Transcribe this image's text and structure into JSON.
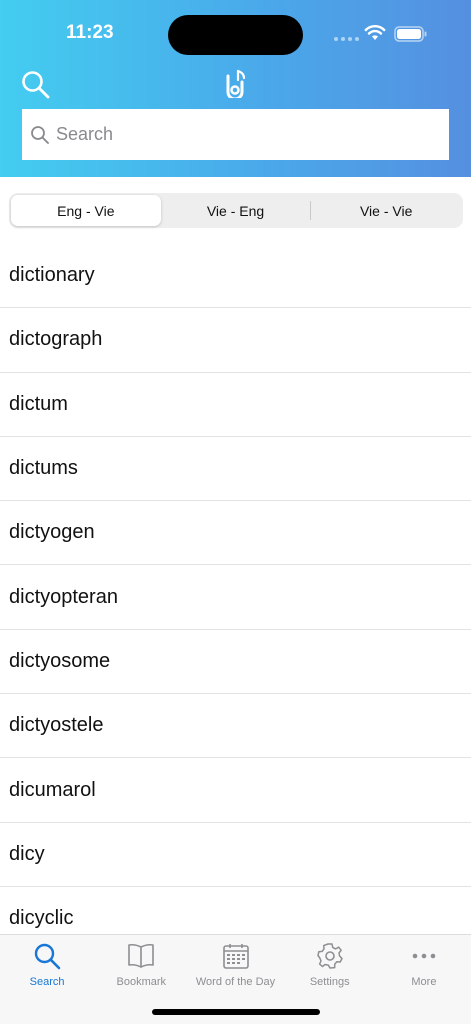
{
  "status_bar": {
    "time": "11:23"
  },
  "header": {
    "colors": {
      "gradient_start": "#43cdf0",
      "gradient_end": "#5590e0"
    }
  },
  "search": {
    "placeholder": "Search",
    "value": ""
  },
  "segments": [
    {
      "label": "Eng - Vie",
      "active": true
    },
    {
      "label": "Vie - Eng",
      "active": false
    },
    {
      "label": "Vie - Vie",
      "active": false
    }
  ],
  "words": [
    "dictionary",
    "dictograph",
    "dictum",
    "dictums",
    "dictyogen",
    "dictyopteran",
    "dictyosome",
    "dictyostele",
    "dicumarol",
    "dicy",
    "dicyclic"
  ],
  "tabs": [
    {
      "label": "Search",
      "icon": "search-icon",
      "active": true
    },
    {
      "label": "Bookmark",
      "icon": "book-icon",
      "active": false
    },
    {
      "label": "Word of the Day",
      "icon": "calendar-icon",
      "active": false
    },
    {
      "label": "Settings",
      "icon": "gear-icon",
      "active": false
    },
    {
      "label": "More",
      "icon": "ellipsis-icon",
      "active": false
    }
  ],
  "accent_color": "#1877d6"
}
